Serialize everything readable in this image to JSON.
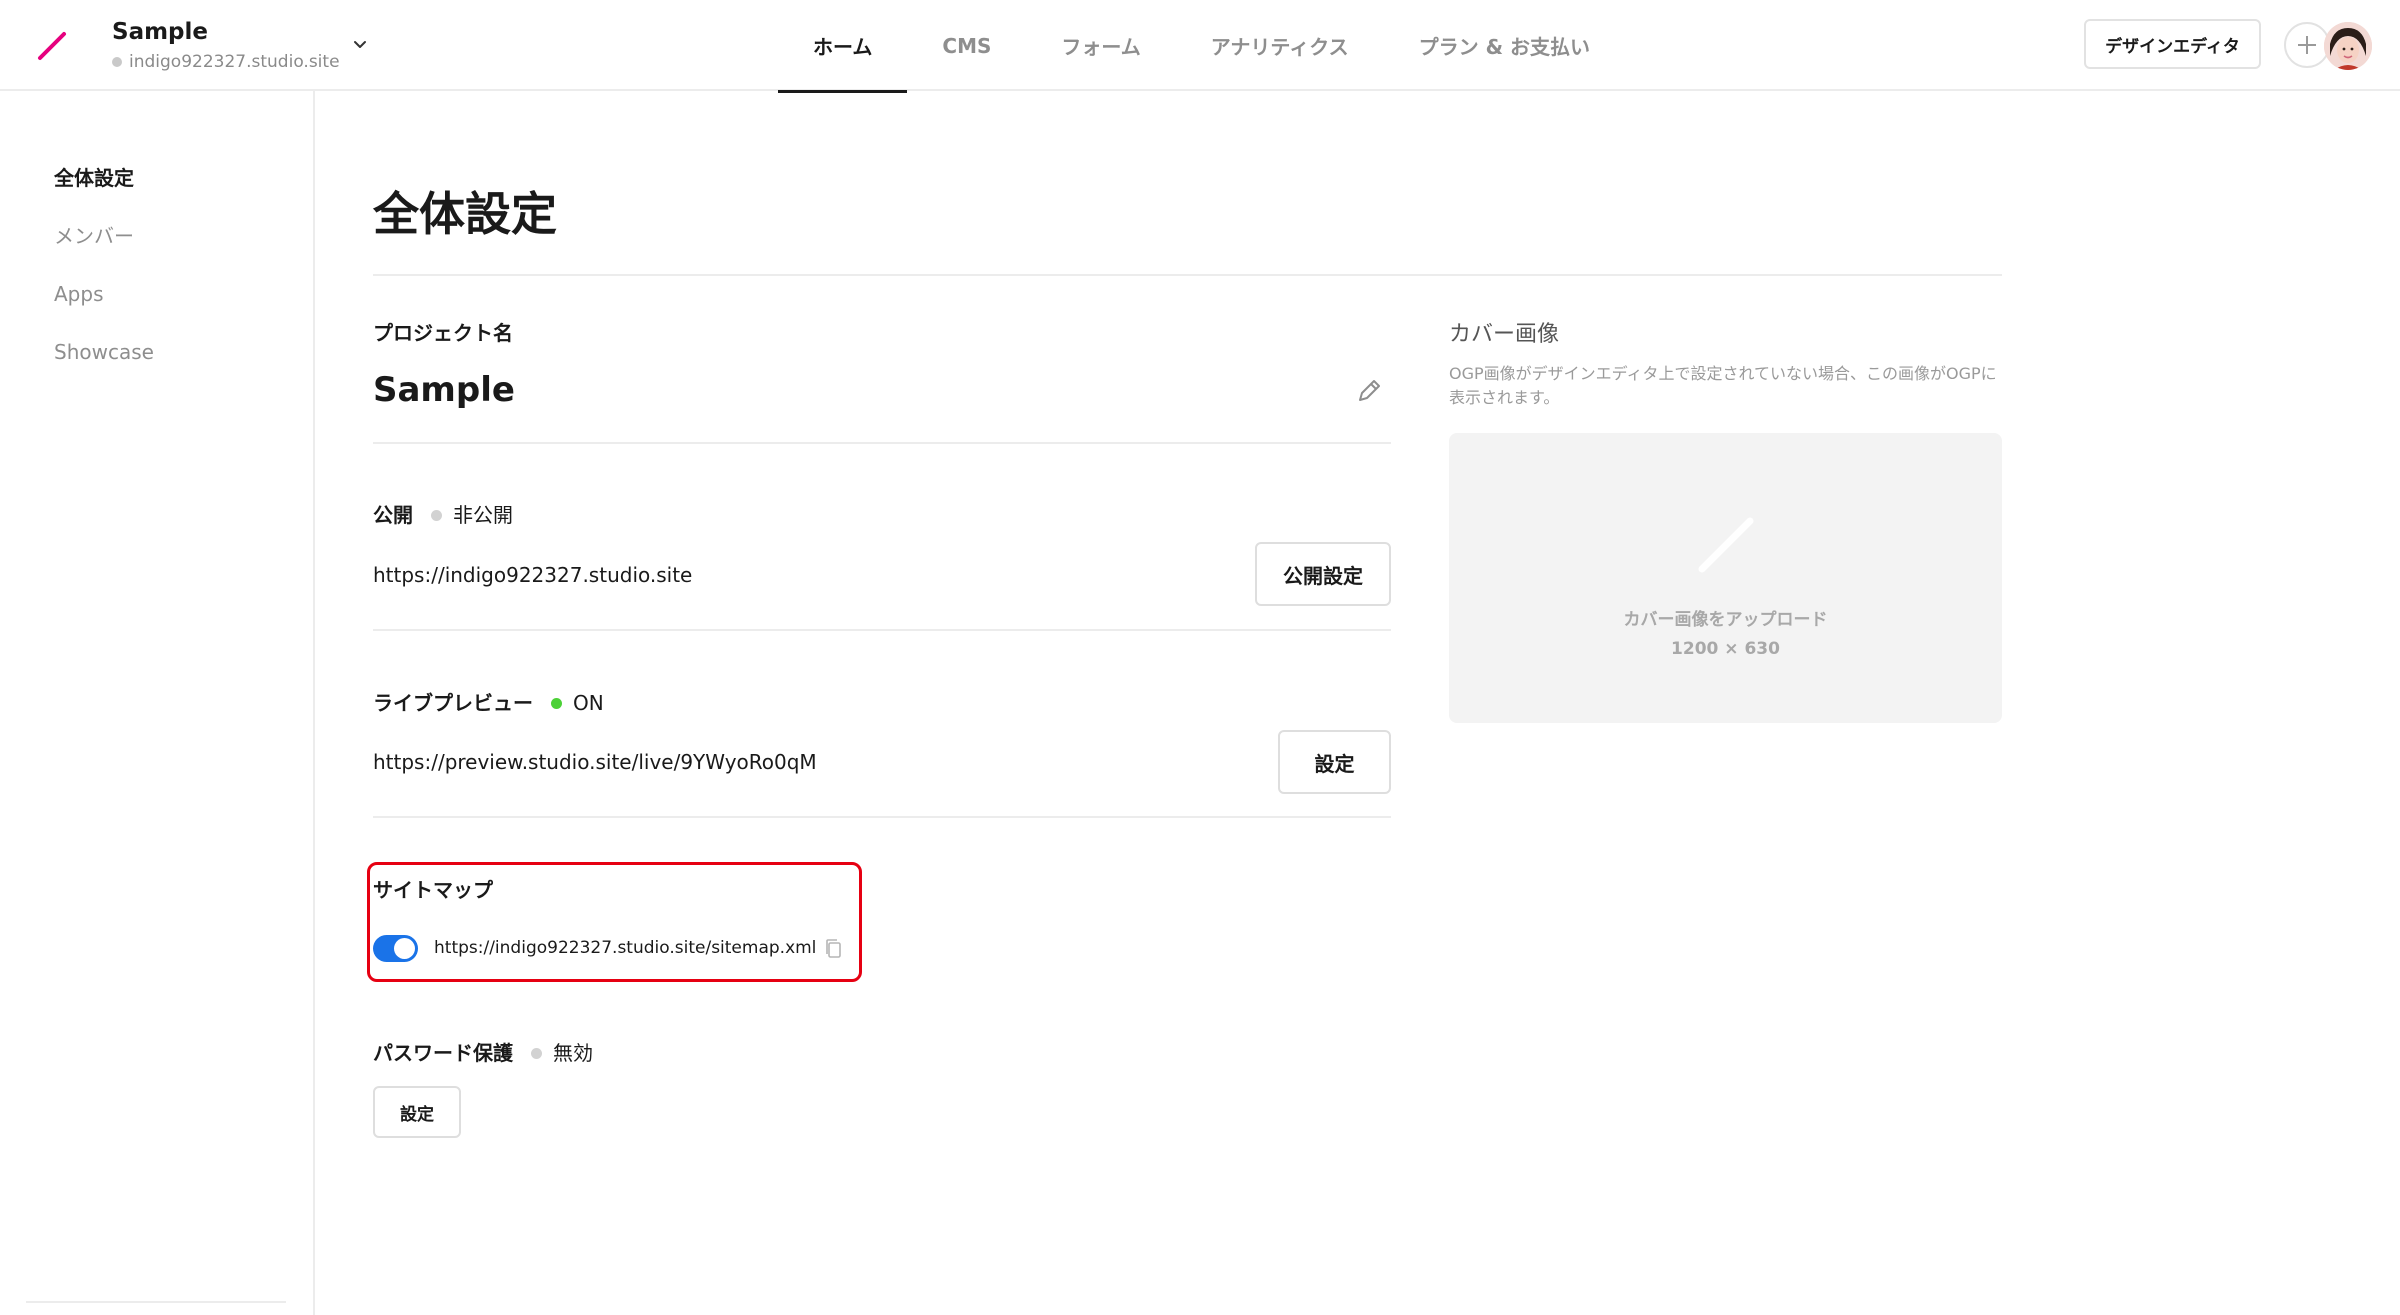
{
  "header": {
    "project_name": "Sample",
    "project_domain": "indigo922327.studio.site",
    "tabs": [
      {
        "label": "ホーム",
        "active": true
      },
      {
        "label": "CMS",
        "active": false
      },
      {
        "label": "フォーム",
        "active": false
      },
      {
        "label": "アナリティクス",
        "active": false
      },
      {
        "label": "プラン & お支払い",
        "active": false
      }
    ],
    "design_editor_label": "デザインエディタ",
    "accent_color": "#e6007e"
  },
  "sidebar": {
    "items": [
      {
        "label": "全体設定",
        "active": true
      },
      {
        "label": "メンバー",
        "active": false
      },
      {
        "label": "Apps",
        "active": false
      },
      {
        "label": "Showcase",
        "active": false
      }
    ]
  },
  "main": {
    "page_title": "全体設定",
    "project_name_label": "プロジェクト名",
    "project_name_value": "Sample",
    "publish": {
      "label": "公開",
      "status": "非公開",
      "url": "https://indigo922327.studio.site",
      "button": "公開設定"
    },
    "live_preview": {
      "label": "ライブプレビュー",
      "status": "ON",
      "url": "https://preview.studio.site/live/9YWyoRo0qM",
      "button": "設定"
    },
    "sitemap": {
      "label": "サイトマップ",
      "url": "https://indigo922327.studio.site/sitemap.xml",
      "enabled": true,
      "highlight_color": "#e60012"
    },
    "password": {
      "label": "パスワード保護",
      "status": "無効",
      "button": "設定"
    },
    "cover": {
      "title": "カバー画像",
      "description": "OGP画像がデザインエディタ上で設定されていない場合、この画像がOGPに表示されます。",
      "upload_label": "カバー画像をアップロード",
      "size": "1200 × 630"
    }
  }
}
